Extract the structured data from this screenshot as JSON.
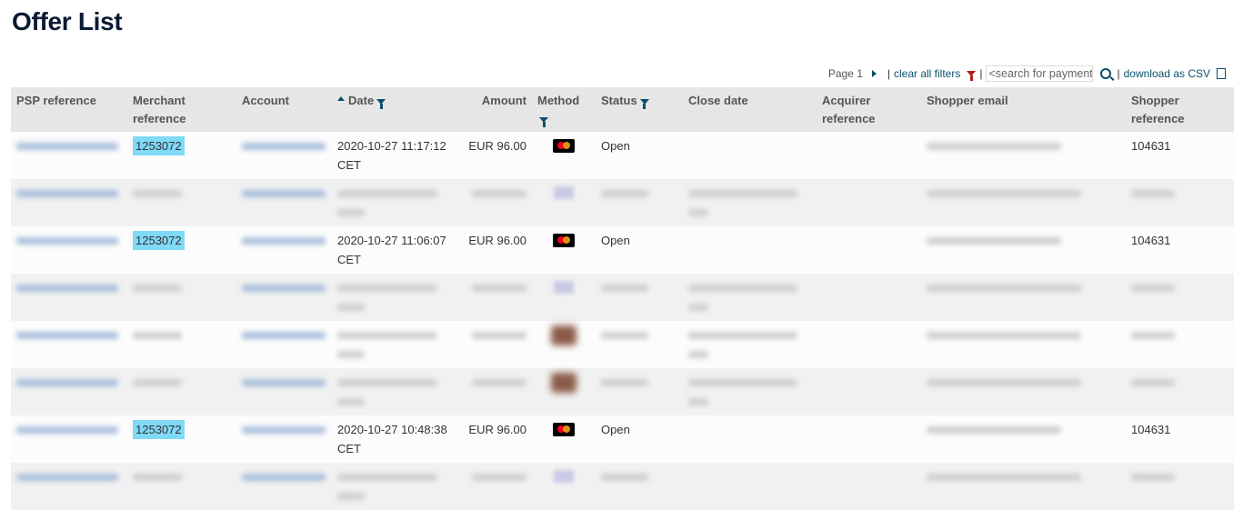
{
  "page": {
    "title": "Offer List"
  },
  "toolbar": {
    "page_label": "Page 1",
    "clear_filters": "clear all filters",
    "search_placeholder": "<search for payment",
    "download_csv": "download as CSV",
    "separator": "|"
  },
  "table": {
    "headers": {
      "psp": "PSP reference",
      "merchant": "Merchant reference",
      "account": "Account",
      "date": "Date",
      "amount": "Amount",
      "method": "Method",
      "status": "Status",
      "close_date": "Close date",
      "acquirer": "Acquirer reference",
      "email": "Shopper email",
      "shopper": "Shopper reference"
    },
    "rows": [
      {
        "blurred": false,
        "merchant": "1253072",
        "date": "2020-10-27 11:17:12 CET",
        "amount": "EUR 96.00",
        "method_icon": "mastercard-icon",
        "status": "Open",
        "close_date": "",
        "shopper": "104631"
      },
      {
        "blurred": true,
        "merchant": "",
        "date": "",
        "amount": "",
        "method_icon": "visa-icon",
        "status": "",
        "close_date": "",
        "shopper": ""
      },
      {
        "blurred": false,
        "merchant": "1253072",
        "date": "2020-10-27 11:06:07 CET",
        "amount": "EUR 96.00",
        "method_icon": "mastercard-icon",
        "status": "Open",
        "close_date": "",
        "shopper": "104631"
      },
      {
        "blurred": true,
        "merchant": "",
        "date": "",
        "amount": "",
        "method_icon": "visa-icon",
        "status": "",
        "close_date": "",
        "shopper": ""
      },
      {
        "blurred": true,
        "merchant": "",
        "date": "",
        "amount": "",
        "method_icon": "card-icon",
        "status": "",
        "close_date": "",
        "shopper": ""
      },
      {
        "blurred": true,
        "merchant": "",
        "date": "",
        "amount": "",
        "method_icon": "card-icon",
        "status": "",
        "close_date": "",
        "shopper": ""
      },
      {
        "blurred": false,
        "merchant": "1253072",
        "date": "2020-10-27 10:48:38 CET",
        "amount": "EUR 96.00",
        "method_icon": "mastercard-icon",
        "status": "Open",
        "close_date": "",
        "shopper": "104631"
      },
      {
        "blurred": true,
        "merchant": "",
        "date": "",
        "amount": "",
        "method_icon": "visa-icon",
        "status": "",
        "close_date": "",
        "shopper": ""
      }
    ]
  },
  "colors": {
    "accent": "#0b4f6c",
    "highlight": "#7fd9f7",
    "header_bg": "#e6e6e6",
    "title": "#0b1a33"
  }
}
